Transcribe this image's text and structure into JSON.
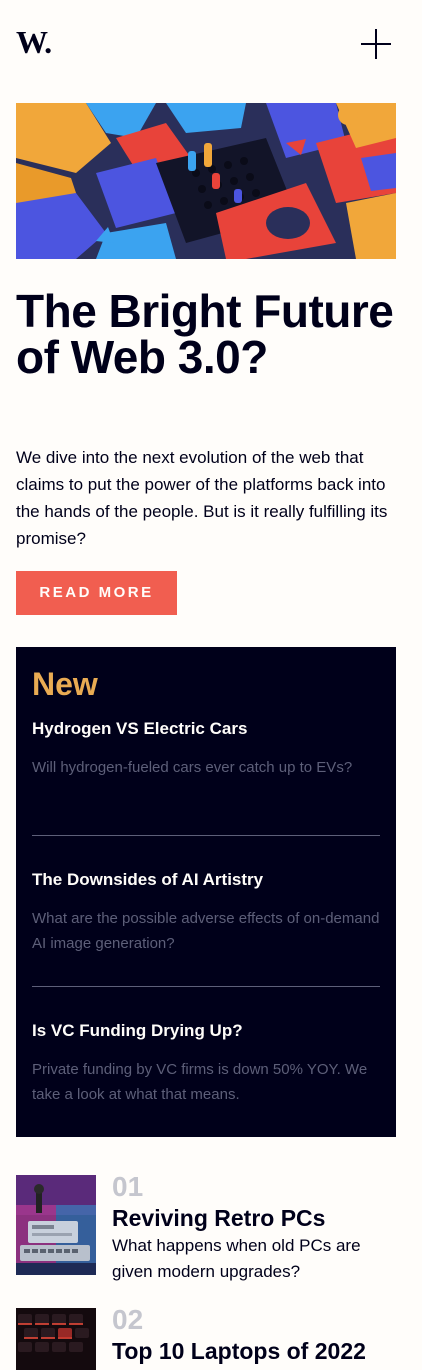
{
  "header": {
    "logo": "W."
  },
  "hero": {
    "title": "The Bright Future of Web 3.0?",
    "description": "We dive into the next evolution of the web that claims to put the power of the platforms back into the hands of the people. But is it really fulfilling its promise?",
    "button_label": "READ MORE"
  },
  "new_panel": {
    "heading": "New",
    "items": [
      {
        "title": "Hydrogen VS Electric Cars",
        "description": "Will hydrogen-fueled cars ever catch up to EVs?"
      },
      {
        "title": "The Downsides of AI Artistry",
        "description": "What are the possible adverse effects of on-demand AI image generation?"
      },
      {
        "title": "Is VC Funding Drying Up?",
        "description": "Private funding by VC firms is down 50% YOY. We take a look at what that means."
      }
    ]
  },
  "articles": [
    {
      "number": "01",
      "title": "Reviving Retro PCs",
      "description": "What happens when old PCs are given modern upgrades?"
    },
    {
      "number": "02",
      "title": "Top 10 Laptops of 2022",
      "description": ""
    }
  ],
  "colors": {
    "background": "#fffdfa",
    "dark_navy": "#00001a",
    "soft_red": "#f15e50",
    "soft_orange": "#e9ab53",
    "grayish_blue": "#5d5f79",
    "number_gray": "#c5c6ce"
  }
}
